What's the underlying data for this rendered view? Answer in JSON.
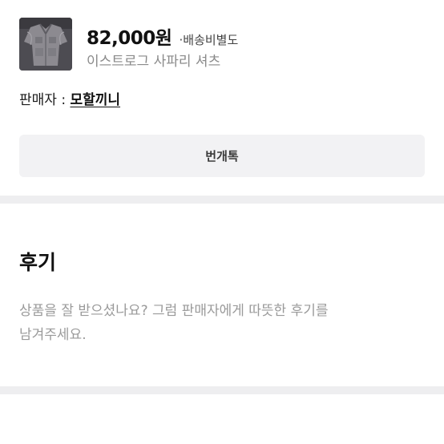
{
  "product": {
    "price": "82,000원",
    "shipping": "·배송비별도",
    "title": "이스트로그 사파리 셔츠",
    "thumbnail_icon": "product-photo-shirt"
  },
  "seller": {
    "label": "판매자 : ",
    "name": "모할끼니"
  },
  "chat_button": {
    "label": "번개톡"
  },
  "review": {
    "heading": "후기",
    "line1": "상품을 잘 받으셨나요? 그럼 판매자에게 따뜻한 후기를",
    "line2": "남겨주세요."
  },
  "colors": {
    "divider": "#eeeef0",
    "button_bg": "#f2f2f4",
    "muted_text": "#9a9a9a"
  }
}
